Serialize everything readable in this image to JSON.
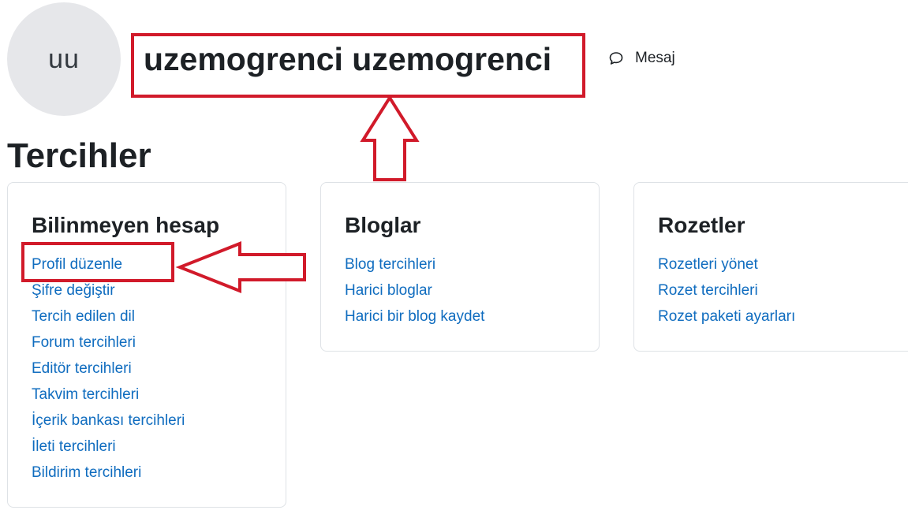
{
  "header": {
    "avatar_initials": "uu",
    "user_name": "uzemogrenci uzemogrenci",
    "message_label": "Mesaj",
    "message_icon": "speech-bubble-icon"
  },
  "page": {
    "section_title": "Tercihler"
  },
  "cards": [
    {
      "title": "Bilinmeyen hesap",
      "links": [
        "Profil düzenle",
        "Şifre değiştir",
        "Tercih edilen dil",
        "Forum tercihleri",
        "Editör tercihleri",
        "Takvim tercihleri",
        "İçerik bankası tercihleri",
        "İleti tercihleri",
        "Bildirim tercihleri"
      ]
    },
    {
      "title": "Bloglar",
      "links": [
        "Blog tercihleri",
        "Harici bloglar",
        "Harici bir blog kaydet"
      ]
    },
    {
      "title": "Rozetler",
      "links": [
        "Rozetleri yönet",
        "Rozet tercihleri",
        "Rozet paketi ayarları"
      ]
    }
  ],
  "colors": {
    "link": "#0f6cbf",
    "annotation": "#d11a2a",
    "avatar_bg": "#e6e7ea"
  }
}
